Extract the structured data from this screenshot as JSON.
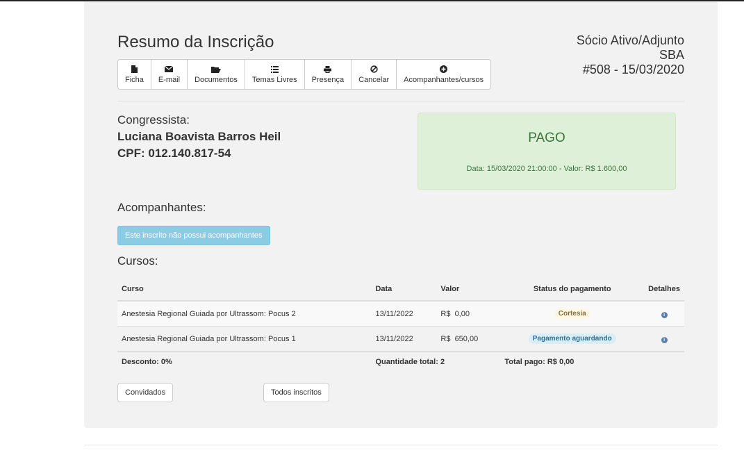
{
  "page": {
    "title": "Resumo da Inscrição"
  },
  "toolbar": {
    "items": [
      {
        "label": "Ficha",
        "icon": "file-icon"
      },
      {
        "label": "E-mail",
        "icon": "envelope-icon"
      },
      {
        "label": "Documentos",
        "icon": "folder-open-icon"
      },
      {
        "label": "Temas Livres",
        "icon": "list-icon"
      },
      {
        "label": "Presença",
        "icon": "print-icon"
      },
      {
        "label": "Cancelar",
        "icon": "ban-icon"
      },
      {
        "label": "Acompanhantes/cursos",
        "icon": "plus-circle-icon"
      }
    ]
  },
  "member": {
    "category": "Sócio Ativo/Adjunto",
    "org": "SBA",
    "registration": "#508 - 15/03/2020"
  },
  "congressista": {
    "label": "Congressista:",
    "name": "Luciana Boavista Barros Heil",
    "cpf": "CPF: 012.140.817-54"
  },
  "payment": {
    "status": "PAGO",
    "detail": "Data: 15/03/2020 21:00:00 - Valor: R$ 1.600,00",
    "color": "#3c763d"
  },
  "companions": {
    "heading": "Acompanhantes:",
    "empty_label": "Este inscrito não possui acompanhantes"
  },
  "courses": {
    "heading": "Cursos:",
    "columns": [
      "Curso",
      "Data",
      "Valor",
      "Status do pagamento",
      "Detalhes"
    ],
    "rows": [
      {
        "course": "Anestesia Regional Guiada por Ultrassom: Pocus 2",
        "date": "13/11/2022",
        "value": "R$  0,00",
        "status": "Cortesia"
      },
      {
        "course": "Anestesia Regional Guiada por Ultrassom: Pocus 1",
        "date": "13/11/2022",
        "value": "R$  650,00",
        "status": "Pagamento aguardando"
      }
    ],
    "footer": {
      "discount": "Desconto: 0%",
      "quantity": "Quantidade total: 2",
      "total": "Total pago: R$ 0,00"
    }
  },
  "buttons": {
    "guests": "Convidados",
    "all_registrants": "Todos inscritos"
  }
}
